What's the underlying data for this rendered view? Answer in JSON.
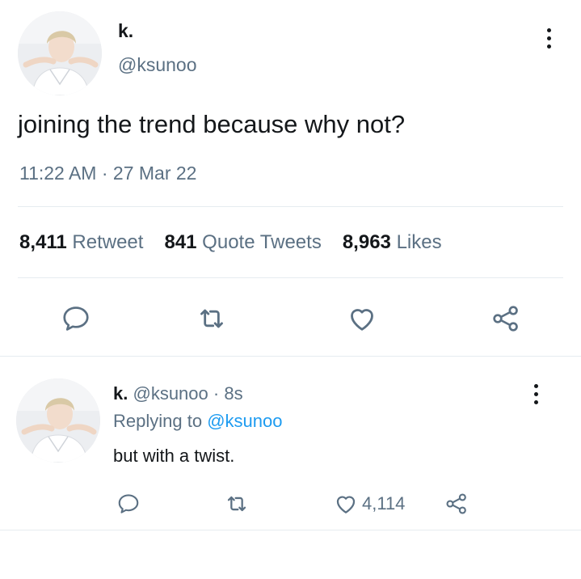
{
  "tweet": {
    "display_name": "k.",
    "handle": "@ksunoo",
    "text": "joining the trend because why not?",
    "timestamp": "11:22 AM · 27 Mar 22",
    "stats": [
      {
        "count": "8,411",
        "label": "Retweet"
      },
      {
        "count": "841",
        "label": "Quote Tweets"
      },
      {
        "count": "8,963",
        "label": "Likes"
      }
    ],
    "actions": [
      "reply-icon",
      "retweet-icon",
      "like-icon",
      "share-icon"
    ]
  },
  "reply": {
    "display_name": "k.",
    "handle": "@ksunoo",
    "separator": "·",
    "age": "8s",
    "replying_to_prefix": "Replying to",
    "replying_to_handle": "@ksunoo",
    "text": "but with a twist.",
    "like_count": "4,114"
  },
  "colors": {
    "text": "#14171a",
    "muted": "#5b7083",
    "link": "#1d9bf0",
    "divider": "#e6ecf0"
  }
}
